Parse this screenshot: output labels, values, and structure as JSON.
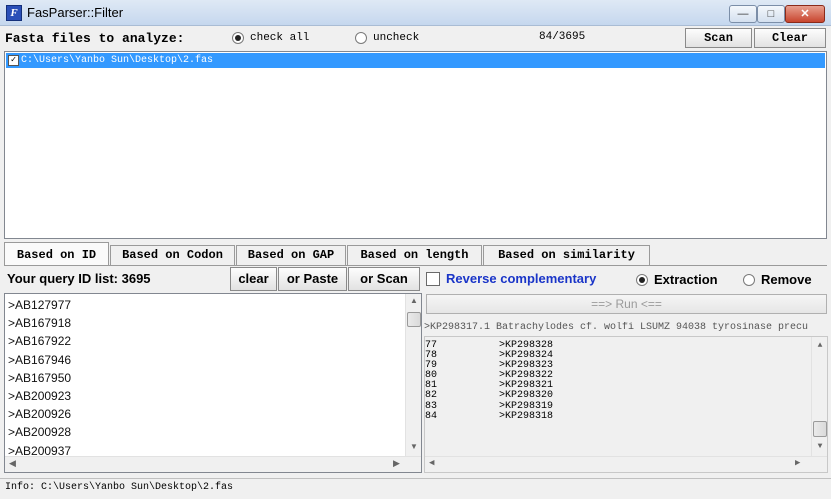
{
  "window": {
    "title": "FasParser::Filter",
    "app_icon": "F"
  },
  "top": {
    "fasta_label": "Fasta files to analyze:",
    "check_all_label": "check all",
    "uncheck_label": "uncheck",
    "count": "84/3695",
    "scan_label": "Scan",
    "clear_label": "Clear"
  },
  "files": [
    {
      "path": "C:\\Users\\Yanbo Sun\\Desktop\\2.fas",
      "checked": true
    }
  ],
  "tabs": [
    {
      "label": "Based on ID",
      "active": true
    },
    {
      "label": "Based on Codon"
    },
    {
      "label": "Based on GAP"
    },
    {
      "label": "Based on length"
    },
    {
      "label": "Based on similarity"
    }
  ],
  "query": {
    "label": "Your query ID list: 3695",
    "clear_label": "clear",
    "paste_label": "or Paste",
    "scan_label": "or Scan"
  },
  "ids": [
    ">AB127977",
    ">AB167918",
    ">AB167922",
    ">AB167946",
    ">AB167950",
    ">AB200923",
    ">AB200926",
    ">AB200928",
    ">AB200937"
  ],
  "options": {
    "reverse_label": "Reverse complementary",
    "extraction_label": "Extraction",
    "remove_label": "Remove",
    "run_label": "==> Run <=="
  },
  "results": {
    "header": ">KP298317.1 Batrachylodes cf. wolfi LSUMZ 94038 tyrosinase precu",
    "rows": [
      {
        "n": "77",
        "id": ">KP298328"
      },
      {
        "n": "78",
        "id": ">KP298324"
      },
      {
        "n": "79",
        "id": ">KP298323"
      },
      {
        "n": "80",
        "id": ">KP298322"
      },
      {
        "n": "81",
        "id": ">KP298321"
      },
      {
        "n": "82",
        "id": ">KP298320"
      },
      {
        "n": "83",
        "id": ">KP298319"
      },
      {
        "n": "84",
        "id": ">KP298318"
      }
    ]
  },
  "status": "Info: C:\\Users\\Yanbo Sun\\Desktop\\2.fas",
  "colors": {
    "selection": "#3399ff",
    "reverse_text": "#1a35c8"
  }
}
